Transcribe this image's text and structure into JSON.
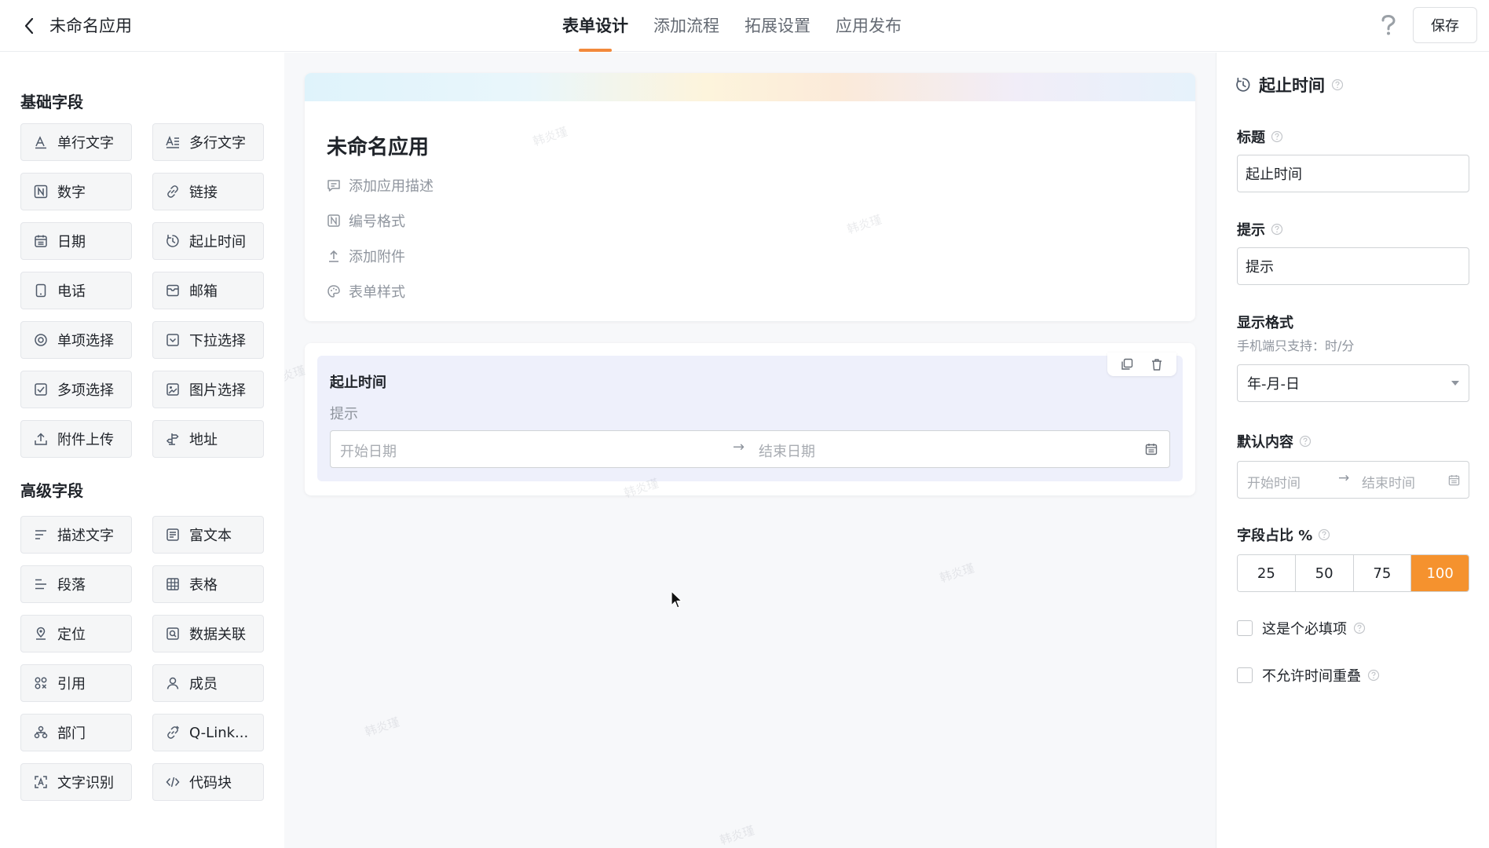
{
  "header": {
    "app_title": "未命名应用",
    "tabs": [
      {
        "label": "表单设计"
      },
      {
        "label": "添加流程"
      },
      {
        "label": "拓展设置"
      },
      {
        "label": "应用发布"
      }
    ],
    "save_label": "保存"
  },
  "sidebar": {
    "basic_title": "基础字段",
    "basic_fields": [
      {
        "label": "单行文字",
        "icon": "single-line-text-icon"
      },
      {
        "label": "多行文字",
        "icon": "multi-line-text-icon"
      },
      {
        "label": "数字",
        "icon": "number-icon"
      },
      {
        "label": "链接",
        "icon": "link-icon"
      },
      {
        "label": "日期",
        "icon": "calendar-icon"
      },
      {
        "label": "起止时间",
        "icon": "time-range-icon"
      },
      {
        "label": "电话",
        "icon": "phone-icon"
      },
      {
        "label": "邮箱",
        "icon": "mail-icon"
      },
      {
        "label": "单项选择",
        "icon": "radio-icon"
      },
      {
        "label": "下拉选择",
        "icon": "dropdown-icon"
      },
      {
        "label": "多项选择",
        "icon": "checkbox-icon"
      },
      {
        "label": "图片选择",
        "icon": "image-icon"
      },
      {
        "label": "附件上传",
        "icon": "upload-icon"
      },
      {
        "label": "地址",
        "icon": "signpost-icon"
      }
    ],
    "advanced_title": "高级字段",
    "advanced_fields": [
      {
        "label": "描述文字",
        "icon": "description-icon"
      },
      {
        "label": "富文本",
        "icon": "rich-text-icon"
      },
      {
        "label": "段落",
        "icon": "paragraph-icon"
      },
      {
        "label": "表格",
        "icon": "table-icon"
      },
      {
        "label": "定位",
        "icon": "location-icon"
      },
      {
        "label": "数据关联",
        "icon": "data-relation-icon"
      },
      {
        "label": "引用",
        "icon": "reference-icon"
      },
      {
        "label": "成员",
        "icon": "member-icon"
      },
      {
        "label": "部门",
        "icon": "department-icon"
      },
      {
        "label": "Q-Link...",
        "icon": "qlink-icon"
      },
      {
        "label": "文字识别",
        "icon": "ocr-icon"
      },
      {
        "label": "代码块",
        "icon": "code-icon"
      }
    ]
  },
  "canvas": {
    "form_name": "未命名应用",
    "meta_items": [
      {
        "label": "添加应用描述",
        "icon": "comment-icon"
      },
      {
        "label": "编号格式",
        "icon": "number-format-icon"
      },
      {
        "label": "添加附件",
        "icon": "upload-icon"
      },
      {
        "label": "表单样式",
        "icon": "palette-icon"
      }
    ],
    "field": {
      "label": "起止时间",
      "hint": "提示",
      "start_placeholder": "开始日期",
      "end_placeholder": "结束日期",
      "arrow": "→"
    },
    "watermark_text": "韩炎瑾"
  },
  "properties": {
    "title": "起止时间",
    "label_title": "标题",
    "title_value": "起止时间",
    "label_hint": "提示",
    "hint_value": "提示",
    "label_format": "显示格式",
    "format_sub": "手机端只支持：时/分",
    "format_value": "年-月-日",
    "label_default": "默认内容",
    "default_start": "开始时间",
    "default_end": "结束时间",
    "default_arrow": "→",
    "label_ratio": "字段占比 %",
    "ratio_options": [
      "25",
      "50",
      "75",
      "100"
    ],
    "ratio_selected": "100",
    "required_label": "这是个必填项",
    "no_overlap_label": "不允许时间重叠"
  },
  "colors": {
    "accent": "#f5922e",
    "tab_underline": "#f2893b",
    "selected_field_bg": "#eef0fb"
  }
}
